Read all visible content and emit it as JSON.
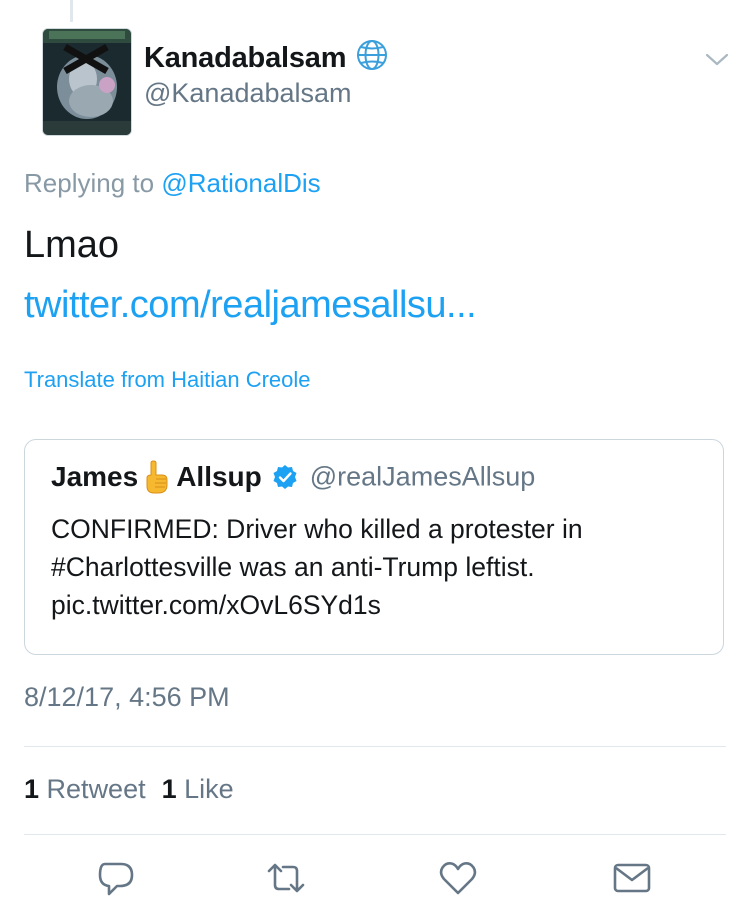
{
  "tweet": {
    "display_name": "Kanadabalsam",
    "username": "@Kanadabalsam",
    "replying_prefix": "Replying to ",
    "replying_to": "@RationalDis",
    "text": "Lmao",
    "link": "twitter.com/realjamesallsu...",
    "translate_label": "Translate from Haitian Creole",
    "timestamp": "8/12/17, 4:56 PM"
  },
  "quote": {
    "name_part1": "James",
    "name_part2": "Allsup",
    "handle": "@realJamesAllsup",
    "line1": "CONFIRMED: Driver who killed a protester in",
    "line2": "#Charlottesville was an anti-Trump leftist.",
    "line3": "pic.twitter.com/xOvL6SYd1s"
  },
  "stats": {
    "retweet_count": "1",
    "retweet_label": "Retweet",
    "like_count": "1",
    "like_label": "Like"
  },
  "icons": {
    "globe": "globe-icon",
    "chevron": "chevron-down-icon",
    "verified": "verified-icon",
    "finger": "pointing-up-emoji",
    "reply": "reply-icon",
    "retweet": "retweet-icon",
    "like": "heart-icon",
    "dm": "envelope-icon"
  },
  "colors": {
    "link_blue": "#1da1f2",
    "secondary_gray": "#657786",
    "border": "#e1e8ed"
  }
}
